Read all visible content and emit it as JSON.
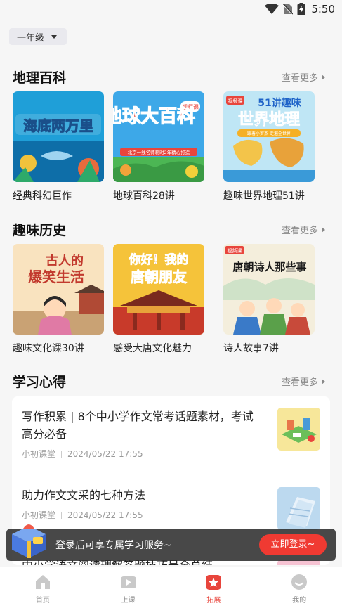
{
  "status_bar": {
    "time": "5:50"
  },
  "grade_selector": {
    "value": "一年级"
  },
  "sections": {
    "geography": {
      "title": "地理百科",
      "more": "查看更多",
      "items": [
        {
          "label": "经典科幻巨作",
          "cover_title": "海底两万里"
        },
        {
          "label": "地球百科28讲",
          "cover_title": "地球大百科",
          "cover_badge": "视频课",
          "cover_sub": "北京一线名师耗时2年精心打造"
        },
        {
          "label": "趣味世界地理51讲",
          "cover_title": "世界地理",
          "cover_top": "51讲趣味",
          "cover_badge": "视频课",
          "cover_sub": "跟着小罗杰 走遍全世界"
        }
      ]
    },
    "history": {
      "title": "趣味历史",
      "more": "查看更多",
      "items": [
        {
          "label": "趣味文化课30讲",
          "cover_title_1": "古人的",
          "cover_title_2": "爆笑生活"
        },
        {
          "label": "感受大唐文化魅力",
          "cover_title_1": "你好！我的",
          "cover_title_2": "唐朝朋友"
        },
        {
          "label": "诗人故事7讲",
          "cover_title": "唐朝诗人那些事",
          "cover_badge": "视频课"
        }
      ]
    },
    "study": {
      "title": "学习心得",
      "more": "查看更多",
      "articles": [
        {
          "title_line1": "写作积累 | 8个中小学作文常考话题素材，考试",
          "title_line2": "高分必备",
          "source": "小初课堂",
          "time": "2024/05/22 17:55"
        },
        {
          "title_line1": "助力作文文采的七种方法",
          "source": "小初课堂",
          "time": "2024/05/22 17:55"
        },
        {
          "title_line1": "中小学语文阅读理解答题技巧最全总结"
        }
      ]
    }
  },
  "login_banner": {
    "text": "登录后可享专属学习服务~",
    "button": "立即登录~"
  },
  "tab_bar": [
    {
      "label": "首页",
      "icon": "home-icon"
    },
    {
      "label": "上课",
      "icon": "video-icon"
    },
    {
      "label": "拓展",
      "icon": "star-icon",
      "active": true
    },
    {
      "label": "我的",
      "icon": "profile-icon"
    }
  ],
  "colors": {
    "accent": "#e8453c",
    "login_button": "#f03a32"
  }
}
